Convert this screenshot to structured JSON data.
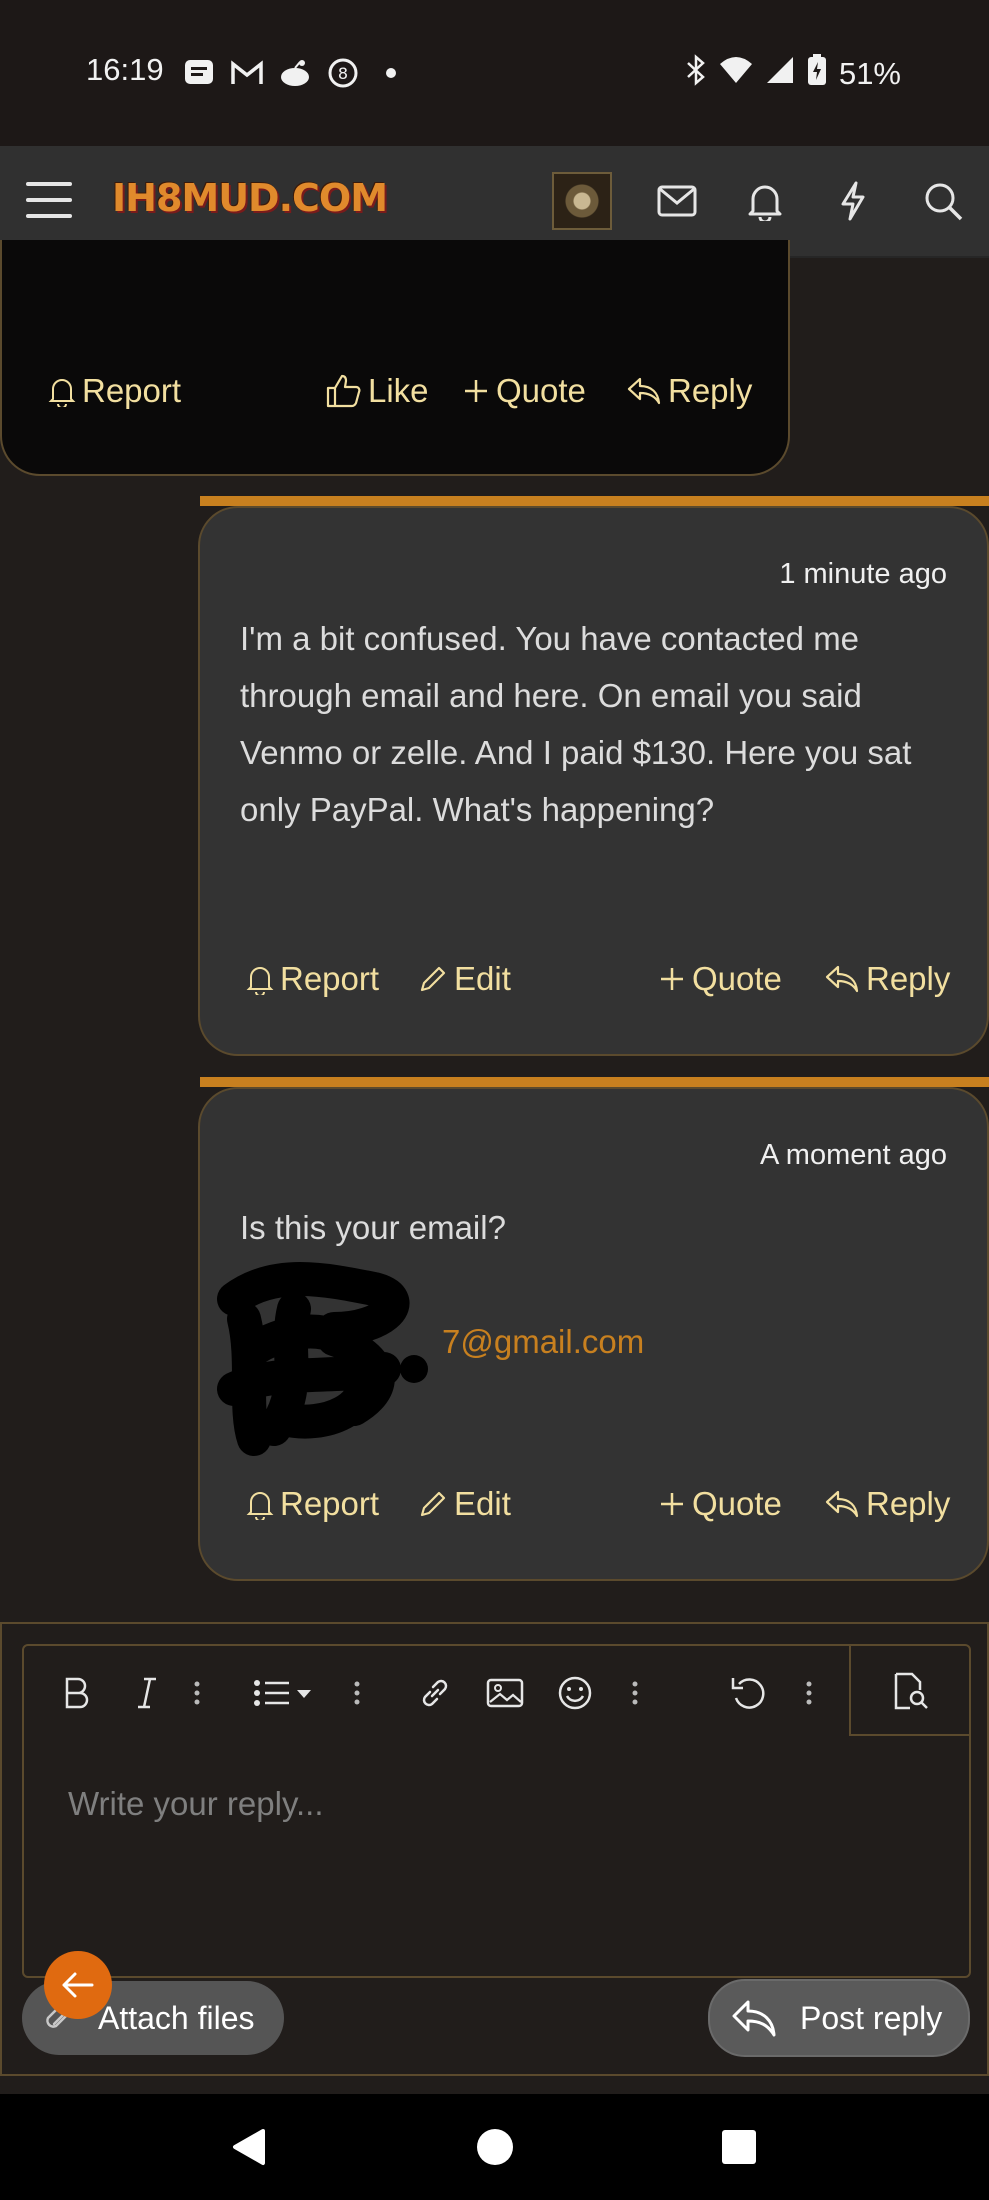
{
  "status_bar": {
    "time": "16:19",
    "battery": "51%",
    "notification_icons": [
      "messages-icon",
      "gmail-icon",
      "reddit-icon",
      "eight-ball-icon",
      "dot-icon"
    ],
    "right_icons": [
      "bluetooth-icon",
      "wifi-icon",
      "signal-icon",
      "battery-icon"
    ]
  },
  "header": {
    "logo_text": "IH8MUD.COM",
    "icons": [
      "menu-icon",
      "avatar",
      "mail-icon",
      "bell-icon",
      "bolt-icon",
      "search-icon"
    ]
  },
  "posts": [
    {
      "actions": {
        "report": "Report",
        "like": "Like",
        "quote": "Quote",
        "reply": "Reply"
      }
    },
    {
      "timestamp": "1 minute ago",
      "text": "I'm a bit confused. You have contacted me through email and here. On email you said Venmo or zelle. And I paid $130. Here you sat only PayPal. What's happening?",
      "actions": {
        "report": "Report",
        "edit": "Edit",
        "quote": "Quote",
        "reply": "Reply"
      }
    },
    {
      "timestamp": "A moment ago",
      "text": "Is this your email?",
      "email_visible": "7@gmail.com",
      "actions": {
        "report": "Report",
        "edit": "Edit",
        "quote": "Quote",
        "reply": "Reply"
      }
    }
  ],
  "editor": {
    "toolbar": [
      "bold-icon",
      "italic-icon",
      "more-icon",
      "list-icon",
      "more-icon",
      "link-icon",
      "image-icon",
      "emoji-icon",
      "more-icon",
      "undo-icon",
      "more-icon",
      "preview-icon"
    ],
    "placeholder": "Write your reply...",
    "attach_label": "Attach files",
    "post_label": "Post reply"
  },
  "colors": {
    "accent": "#c8801f",
    "action_text": "#f2dfa0",
    "card": "#333333",
    "background": "#211d1b"
  }
}
